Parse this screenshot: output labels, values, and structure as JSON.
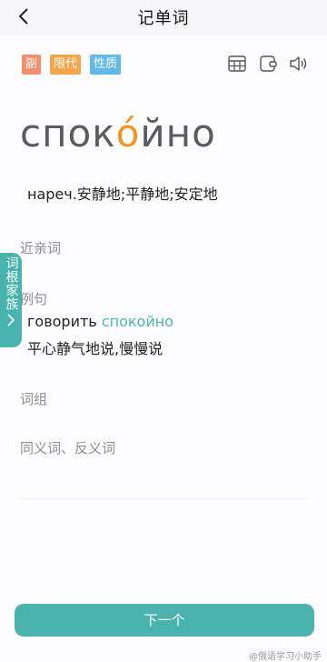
{
  "header": {
    "title": "记单词"
  },
  "tags": {
    "part_of_speech": "副",
    "limit": "限代",
    "nature": "性质"
  },
  "word": {
    "before_stress": "спок",
    "stress": "о́",
    "after_stress": "йно"
  },
  "meaning": "нареч.安静地;平静地;安定地",
  "sections": {
    "synonyms_near": "近亲词",
    "examples": "例句",
    "phrases": "词组",
    "synonyms_antonyms": "同义词、反义词"
  },
  "example": {
    "ru_prefix": "говорить ",
    "ru_highlight": "спокойно",
    "zh": "平心静气地说,慢慢说"
  },
  "side_tab": {
    "label": "词根家族"
  },
  "buttons": {
    "next": "下一个"
  },
  "icons": {
    "back": "back-arrow-icon",
    "table": "table-icon",
    "notebook": "notebook-icon",
    "speaker": "speaker-icon"
  },
  "colors": {
    "accent": "#4bb3ae",
    "stress": "#f39520",
    "tag_adverb": "#f58e6a",
    "tag_limit": "#f5a54a",
    "tag_nature": "#61b8ea"
  },
  "watermark": "@俄语学习小助手"
}
